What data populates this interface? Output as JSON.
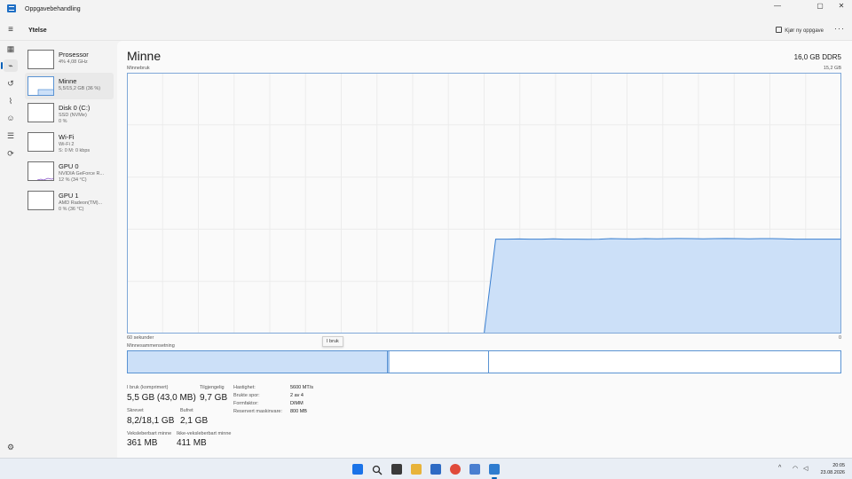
{
  "window": {
    "title": "Oppgavebehandling",
    "minimize": "—",
    "maximize": "▢",
    "close": "✕"
  },
  "header": {
    "section": "Ytelse",
    "run_task": "Kjør ny oppgave",
    "more": "···"
  },
  "nav": [
    {
      "icon": "hamburger-icon"
    },
    {
      "icon": "processes-icon"
    },
    {
      "icon": "performance-icon",
      "active": true
    },
    {
      "icon": "app-history-icon"
    },
    {
      "icon": "startup-apps-icon"
    },
    {
      "icon": "users-icon"
    },
    {
      "icon": "details-icon"
    },
    {
      "icon": "services-icon"
    },
    {
      "icon": "settings-icon"
    }
  ],
  "perf_items": [
    {
      "name": "Prosessor",
      "sub1": "4% 4,08 GHz",
      "sub2": ""
    },
    {
      "name": "Minne",
      "sub1": "5,5/15,2 GB (36 %)",
      "sub2": "",
      "active": true
    },
    {
      "name": "Disk 0 (C:)",
      "sub1": "SSD (NVMe)",
      "sub2": "0 %"
    },
    {
      "name": "Wi-Fi",
      "sub1": "Wi-Fi 2",
      "sub2": "S: 0 M: 0 kbps"
    },
    {
      "name": "GPU 0",
      "sub1": "NVIDIA GeForce R...",
      "sub2": "12 % (34 °C)"
    },
    {
      "name": "GPU 1",
      "sub1": "AMD Radeon(TM)...",
      "sub2": "0 % (36 °C)"
    }
  ],
  "main": {
    "title": "Minne",
    "total": "16,0 GB DDR5",
    "usage_label": "Minnebruk",
    "max_label": "15,2 GB",
    "time_left": "60 sekunder",
    "time_right": "0",
    "composition_label": "Minnesammensetning",
    "tooltip": "I bruk"
  },
  "memory_usage": {
    "max_gb": 15.2,
    "fill_color": "#cce0f8",
    "line_color": "#3a7fd0",
    "samples": [
      0,
      0,
      0,
      0,
      0,
      0,
      0,
      0,
      0,
      0,
      0,
      0,
      0,
      0,
      0,
      0,
      0,
      0,
      0,
      0,
      0,
      0,
      0,
      0,
      0,
      0,
      0,
      0,
      0,
      0,
      0,
      0,
      5.5,
      5.5,
      5.51,
      5.5,
      5.5,
      5.52,
      5.5,
      5.5,
      5.49,
      5.5,
      5.53,
      5.52,
      5.51,
      5.53,
      5.52,
      5.53,
      5.54,
      5.53,
      5.52,
      5.53,
      5.54,
      5.53,
      5.52,
      5.53,
      5.53,
      5.52,
      5.5,
      5.5,
      5.5,
      5.5,
      5.5
    ]
  },
  "composition": {
    "in_use_fraction": 0.365,
    "modified_fraction": 0.003,
    "standby_fraction": 0.14,
    "in_use_color": "#cce0f8",
    "modified_color": "#9fc2ea"
  },
  "stats": {
    "in_use_label": "I bruk (komprimert)",
    "in_use_value": "5,5 GB (43,0 MB)",
    "available_label": "Tilgjengelig",
    "available_value": "9,7 GB",
    "committed_label": "Skrevet",
    "committed_value": "8,2/18,1 GB",
    "cached_label": "Bufret",
    "cached_value": "2,1 GB",
    "paged_label": "Veksleberbart minne",
    "paged_value": "361 MB",
    "nonpaged_label": "Ikke-veksleberbart minne",
    "nonpaged_value": "411 MB"
  },
  "specs": [
    {
      "label": "Hastighet:",
      "value": "5600 MT/s"
    },
    {
      "label": "Brukte spor:",
      "value": "2 av 4"
    },
    {
      "label": "Formfaktor:",
      "value": "DIMM"
    },
    {
      "label": "Reservert maskinvare:",
      "value": "800 MB"
    }
  ],
  "taskbar": {
    "icons": [
      {
        "name": "start-icon",
        "color": "#1a73e8"
      },
      {
        "name": "search-icon",
        "color": "#2a2a2a"
      },
      {
        "name": "task-view-icon",
        "color": "#3a3a3a"
      },
      {
        "name": "file-explorer-icon",
        "color": "#e8b33a"
      },
      {
        "name": "store-icon",
        "color": "#2e6bc4"
      },
      {
        "name": "chrome-icon",
        "color": "#e04a3a"
      },
      {
        "name": "photos-icon",
        "color": "#4a7fd0"
      },
      {
        "name": "task-manager-icon",
        "color": "#2f7ccf"
      }
    ],
    "tray_chevron": "^",
    "time": "20:05",
    "date": "23.08.2026"
  }
}
